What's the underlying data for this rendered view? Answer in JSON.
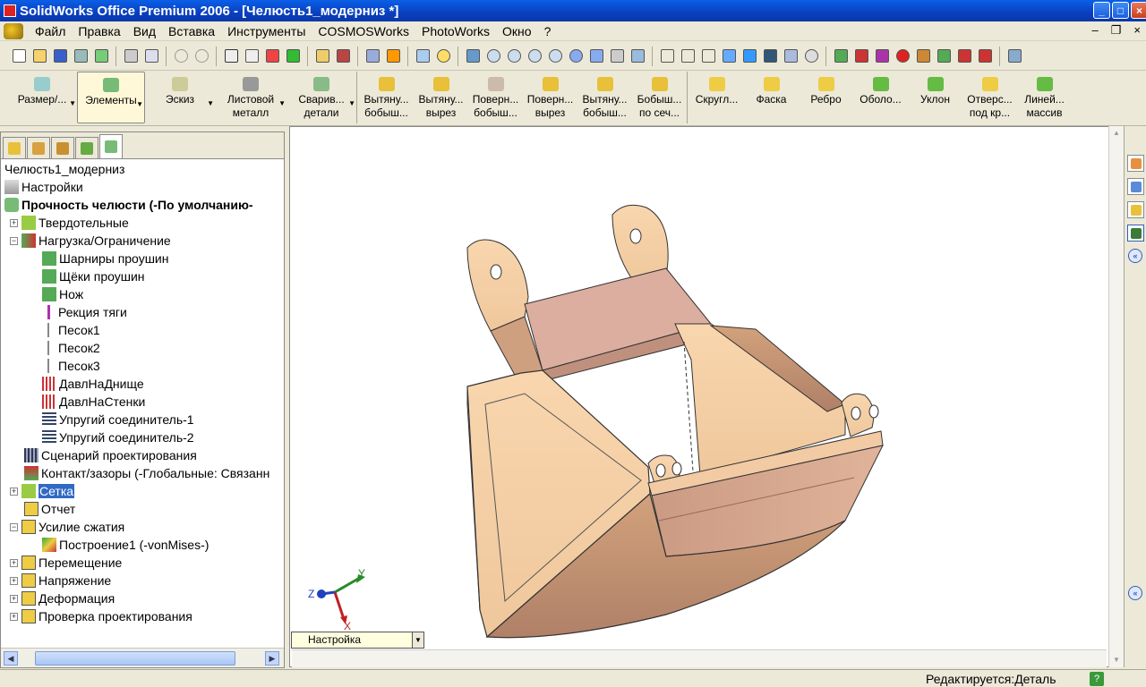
{
  "window": {
    "title": "SolidWorks Office Premium 2006 - [Челюсть1_модерниз *]"
  },
  "menu": {
    "items": [
      "Файл",
      "Правка",
      "Вид",
      "Вставка",
      "Инструменты",
      "COSMOSWorks",
      "PhotoWorks",
      "Окно",
      "?"
    ]
  },
  "commandmanager": {
    "buttons": [
      {
        "label": "Размер/...",
        "icon": "dimension-icon"
      },
      {
        "label": "Элементы",
        "icon": "features-icon"
      },
      {
        "label": "Эскиз",
        "icon": "sketch-icon"
      },
      {
        "label": "Листовой\nметалл",
        "icon": "sheet-metal-icon"
      },
      {
        "label": "Сварив...\nдетали",
        "icon": "weldments-icon"
      }
    ],
    "features": [
      {
        "label": "Вытяну...\nбобыш...",
        "icon": "extruded-boss-icon"
      },
      {
        "label": "Вытяну...\nвырез",
        "icon": "extruded-cut-icon"
      },
      {
        "label": "Поверн...\nбобыш...",
        "icon": "revolved-boss-icon"
      },
      {
        "label": "Поверн...\nвырез",
        "icon": "revolved-cut-icon"
      },
      {
        "label": "Вытяну...\nбобыш...",
        "icon": "swept-boss-icon"
      },
      {
        "label": "Бобыш...\nпо сеч...",
        "icon": "lofted-boss-icon"
      }
    ],
    "features2": [
      {
        "label": "Скругл...",
        "icon": "fillet-icon"
      },
      {
        "label": "Фаска",
        "icon": "chamfer-icon"
      },
      {
        "label": "Ребро",
        "icon": "rib-icon"
      },
      {
        "label": "Оболо...",
        "icon": "shell-icon"
      },
      {
        "label": "Уклон",
        "icon": "draft-icon"
      },
      {
        "label": "Отверс...\nпод кр...",
        "icon": "hole-wizard-icon"
      },
      {
        "label": "Линей...\nмассив",
        "icon": "linear-pattern-icon"
      }
    ]
  },
  "tree": {
    "root": "Челюсть1_модерниз",
    "settings": "Настройки",
    "study": "Прочность челюсти (-По умолчанию-",
    "items": [
      {
        "label": "Твердотельные",
        "icon": "solids-icon"
      },
      {
        "label": "Нагрузка/Ограничение",
        "icon": "loads-icon"
      },
      {
        "label": "Шарниры проушин",
        "icon": "fixture-icon"
      },
      {
        "label": "Щёки проушин",
        "icon": "fixture-icon"
      },
      {
        "label": "Нож",
        "icon": "fixture-icon"
      },
      {
        "label": "Рекция тяги",
        "icon": "force-icon"
      },
      {
        "label": "Песок1",
        "icon": "gravity-icon"
      },
      {
        "label": "Песок2",
        "icon": "gravity-icon"
      },
      {
        "label": "Песок3",
        "icon": "gravity-icon"
      },
      {
        "label": "ДавлНаДнище",
        "icon": "pressure-icon"
      },
      {
        "label": "ДавлНаСтенки",
        "icon": "pressure-icon"
      },
      {
        "label": "Упругий соединитель-1",
        "icon": "elastic-support-icon"
      },
      {
        "label": "Упругий соединитель-2",
        "icon": "elastic-support-icon"
      },
      {
        "label": "Сценарий проектирования",
        "icon": "design-scenario-icon"
      },
      {
        "label": "Контакт/зазоры (-Глобальные: Связанн",
        "icon": "contact-icon"
      },
      {
        "label": "Сетка",
        "icon": "mesh-icon"
      },
      {
        "label": "Отчет",
        "icon": "report-icon"
      },
      {
        "label": "Усилие сжатия",
        "icon": "folder-icon"
      },
      {
        "label": "Построение1 (-vonMises-)",
        "icon": "plot-icon"
      },
      {
        "label": "Перемещение",
        "icon": "folder-icon"
      },
      {
        "label": "Напряжение",
        "icon": "folder-icon"
      },
      {
        "label": "Деформация",
        "icon": "folder-icon"
      },
      {
        "label": "Проверка проектирования",
        "icon": "folder-icon"
      }
    ]
  },
  "viewport": {
    "configuration": "Настройка",
    "triad": {
      "x": "X",
      "y": "Y",
      "z": "Z"
    }
  },
  "status": {
    "text": "Редактируется:Деталь",
    "help": "?"
  }
}
